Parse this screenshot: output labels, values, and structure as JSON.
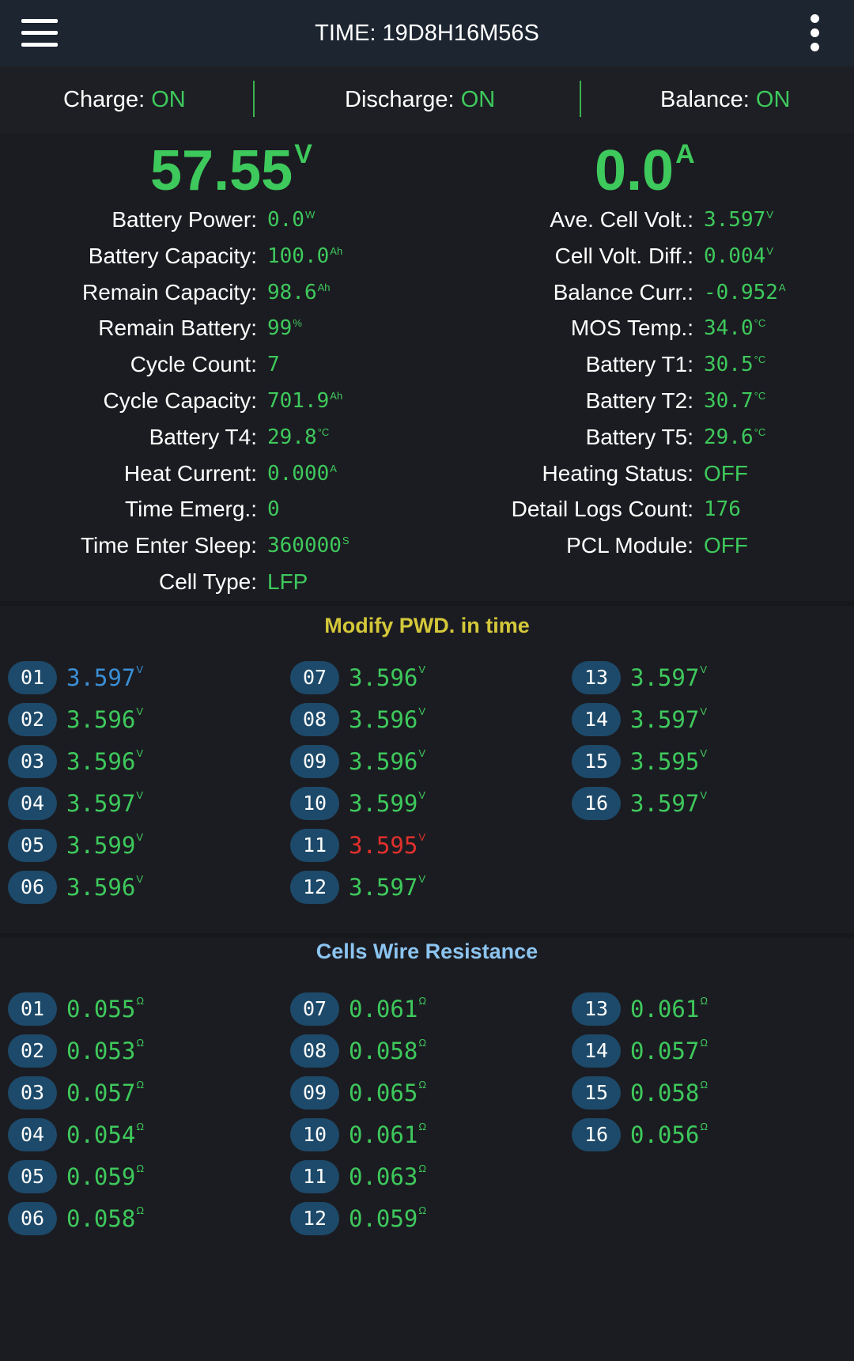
{
  "header": {
    "title": "TIME: 19D8H16M56S",
    "menu_icon": "hamburger-menu-icon",
    "more_icon": "more-vert-icon"
  },
  "status": {
    "charge_label": "Charge:",
    "charge_value": "ON",
    "discharge_label": "Discharge:",
    "discharge_value": "ON",
    "balance_label": "Balance:",
    "balance_value": "ON"
  },
  "summary": {
    "voltage": "57.55",
    "voltage_unit": "V",
    "current": "0.0",
    "current_unit": "A"
  },
  "left_info": [
    {
      "label": "Battery Power:",
      "value": "0.0",
      "unit": "W"
    },
    {
      "label": "Battery Capacity:",
      "value": "100.0",
      "unit": "Ah"
    },
    {
      "label": "Remain Capacity:",
      "value": "98.6",
      "unit": "Ah"
    },
    {
      "label": "Remain Battery:",
      "value": "99",
      "unit": "%"
    },
    {
      "label": "Cycle Count:",
      "value": "7",
      "unit": ""
    },
    {
      "label": "Cycle Capacity:",
      "value": "701.9",
      "unit": "Ah"
    },
    {
      "label": "Battery T4:",
      "value": "29.8",
      "unit": "°C"
    },
    {
      "label": "Heat Current:",
      "value": "0.000",
      "unit": "A"
    },
    {
      "label": "Time Emerg.:",
      "value": "0",
      "unit": ""
    },
    {
      "label": "Time Enter Sleep:",
      "value": "360000",
      "unit": "S"
    },
    {
      "label": "Cell Type:",
      "value": "LFP",
      "unit": ""
    }
  ],
  "right_info": [
    {
      "label": "Ave. Cell Volt.:",
      "value": "3.597",
      "unit": "V"
    },
    {
      "label": "Cell Volt. Diff.:",
      "value": "0.004",
      "unit": "V"
    },
    {
      "label": "Balance Curr.:",
      "value": "-0.952",
      "unit": "A"
    },
    {
      "label": "MOS Temp.:",
      "value": "34.0",
      "unit": "°C"
    },
    {
      "label": "Battery T1:",
      "value": "30.5",
      "unit": "°C"
    },
    {
      "label": "Battery T2:",
      "value": "30.7",
      "unit": "°C"
    },
    {
      "label": "Battery T5:",
      "value": "29.6",
      "unit": "°C"
    },
    {
      "label": "Heating Status:",
      "value": "OFF",
      "unit": ""
    },
    {
      "label": "Detail Logs Count:",
      "value": "176",
      "unit": ""
    },
    {
      "label": "PCL Module:",
      "value": "OFF",
      "unit": ""
    }
  ],
  "cell_voltages": {
    "title": "Modify PWD. in time",
    "title_color": "#d4c83a",
    "colors": {
      "normal": "#3ec95c",
      "max": "#3a8fd6",
      "min": "#e0302c"
    },
    "cells": [
      {
        "id": "01",
        "value": "3.597",
        "unit": "V",
        "state": "max"
      },
      {
        "id": "02",
        "value": "3.596",
        "unit": "V",
        "state": "normal"
      },
      {
        "id": "03",
        "value": "3.596",
        "unit": "V",
        "state": "normal"
      },
      {
        "id": "04",
        "value": "3.597",
        "unit": "V",
        "state": "normal"
      },
      {
        "id": "05",
        "value": "3.599",
        "unit": "V",
        "state": "normal"
      },
      {
        "id": "06",
        "value": "3.596",
        "unit": "V",
        "state": "normal"
      },
      {
        "id": "07",
        "value": "3.596",
        "unit": "V",
        "state": "normal"
      },
      {
        "id": "08",
        "value": "3.596",
        "unit": "V",
        "state": "normal"
      },
      {
        "id": "09",
        "value": "3.596",
        "unit": "V",
        "state": "normal"
      },
      {
        "id": "10",
        "value": "3.599",
        "unit": "V",
        "state": "normal"
      },
      {
        "id": "11",
        "value": "3.595",
        "unit": "V",
        "state": "min"
      },
      {
        "id": "12",
        "value": "3.597",
        "unit": "V",
        "state": "normal"
      },
      {
        "id": "13",
        "value": "3.597",
        "unit": "V",
        "state": "normal"
      },
      {
        "id": "14",
        "value": "3.597",
        "unit": "V",
        "state": "normal"
      },
      {
        "id": "15",
        "value": "3.595",
        "unit": "V",
        "state": "normal"
      },
      {
        "id": "16",
        "value": "3.597",
        "unit": "V",
        "state": "normal"
      }
    ]
  },
  "wire_resistance": {
    "title": "Cells Wire Resistance",
    "title_color": "#8cc4f0",
    "cells": [
      {
        "id": "01",
        "value": "0.055",
        "unit": "Ω"
      },
      {
        "id": "02",
        "value": "0.053",
        "unit": "Ω"
      },
      {
        "id": "03",
        "value": "0.057",
        "unit": "Ω"
      },
      {
        "id": "04",
        "value": "0.054",
        "unit": "Ω"
      },
      {
        "id": "05",
        "value": "0.059",
        "unit": "Ω"
      },
      {
        "id": "06",
        "value": "0.058",
        "unit": "Ω"
      },
      {
        "id": "07",
        "value": "0.061",
        "unit": "Ω"
      },
      {
        "id": "08",
        "value": "0.058",
        "unit": "Ω"
      },
      {
        "id": "09",
        "value": "0.065",
        "unit": "Ω"
      },
      {
        "id": "10",
        "value": "0.061",
        "unit": "Ω"
      },
      {
        "id": "11",
        "value": "0.063",
        "unit": "Ω"
      },
      {
        "id": "12",
        "value": "0.059",
        "unit": "Ω"
      },
      {
        "id": "13",
        "value": "0.061",
        "unit": "Ω"
      },
      {
        "id": "14",
        "value": "0.057",
        "unit": "Ω"
      },
      {
        "id": "15",
        "value": "0.058",
        "unit": "Ω"
      },
      {
        "id": "16",
        "value": "0.056",
        "unit": "Ω"
      }
    ]
  }
}
